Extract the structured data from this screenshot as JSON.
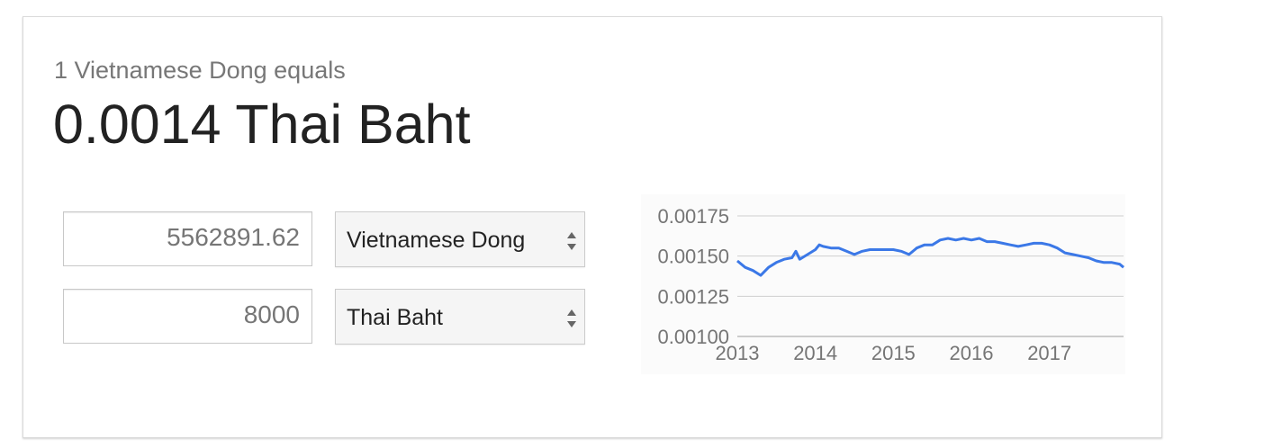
{
  "converter": {
    "subtitle": "1 Vietnamese Dong equals",
    "result": "0.0014 Thai Baht",
    "rows": [
      {
        "amount": "5562891.62",
        "unit": "Vietnamese Dong"
      },
      {
        "amount": "8000",
        "unit": "Thai Baht"
      }
    ]
  },
  "icons": {
    "select_arrows": "up-down-arrows-icon"
  },
  "colors": {
    "line": "#3b78e7",
    "gridline": "#cfcfcf",
    "text_secondary": "#777777",
    "text_primary": "#222222"
  },
  "chart_data": {
    "type": "line",
    "title": "",
    "xlabel": "",
    "ylabel": "",
    "ylim": [
      0.001,
      0.00175
    ],
    "xlim": [
      2013.0,
      2017.95
    ],
    "yticks": [
      "0.00175",
      "0.00150",
      "0.00125",
      "0.00100"
    ],
    "ytick_values": [
      0.00175,
      0.0015,
      0.00125,
      0.001
    ],
    "xticks": [
      "2013",
      "2014",
      "2015",
      "2016",
      "2017"
    ],
    "xtick_values": [
      2013,
      2014,
      2015,
      2016,
      2017
    ],
    "grid": true,
    "legend": "none",
    "series": [
      {
        "x": [
          2013.0,
          2013.1,
          2013.2,
          2013.3,
          2013.4,
          2013.5,
          2013.6,
          2013.7,
          2013.75,
          2013.8,
          2013.9,
          2014.0,
          2014.05,
          2014.1,
          2014.2,
          2014.3,
          2014.4,
          2014.5,
          2014.6,
          2014.7,
          2014.8,
          2014.9,
          2015.0,
          2015.1,
          2015.2,
          2015.3,
          2015.4,
          2015.5,
          2015.6,
          2015.7,
          2015.8,
          2015.9,
          2016.0,
          2016.1,
          2016.2,
          2016.3,
          2016.4,
          2016.5,
          2016.6,
          2016.7,
          2016.8,
          2016.9,
          2017.0,
          2017.1,
          2017.2,
          2017.3,
          2017.4,
          2017.5,
          2017.6,
          2017.7,
          2017.8,
          2017.9,
          2017.95
        ],
        "y": [
          0.00147,
          0.00143,
          0.00141,
          0.00138,
          0.00143,
          0.00146,
          0.00148,
          0.00149,
          0.00153,
          0.00148,
          0.00151,
          0.00154,
          0.00157,
          0.00156,
          0.00155,
          0.00155,
          0.00153,
          0.00151,
          0.00153,
          0.00154,
          0.00154,
          0.00154,
          0.00154,
          0.00153,
          0.00151,
          0.00155,
          0.00157,
          0.00157,
          0.0016,
          0.00161,
          0.0016,
          0.00161,
          0.0016,
          0.00161,
          0.00159,
          0.00159,
          0.00158,
          0.00157,
          0.00156,
          0.00157,
          0.00158,
          0.00158,
          0.00157,
          0.00155,
          0.00152,
          0.00151,
          0.0015,
          0.00149,
          0.00147,
          0.00146,
          0.00146,
          0.00145,
          0.00143
        ]
      }
    ]
  }
}
